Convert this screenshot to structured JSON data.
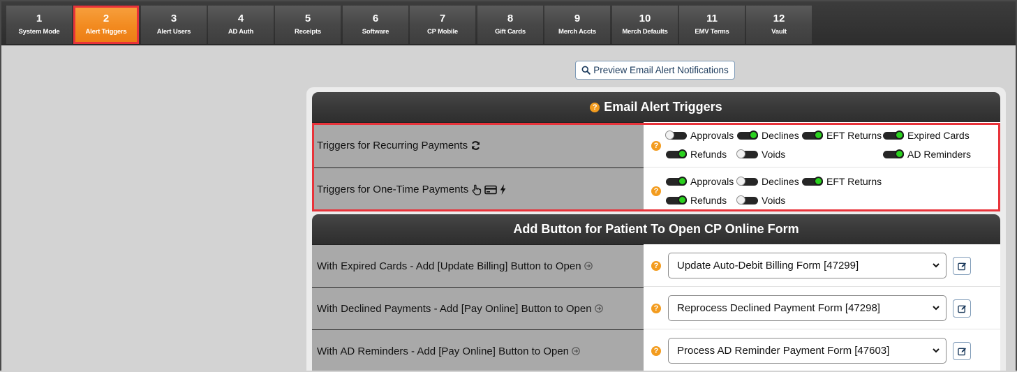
{
  "tabs": [
    {
      "num": "1",
      "label": "System Mode",
      "active": false
    },
    {
      "num": "2",
      "label": "Alert Triggers",
      "active": true
    },
    {
      "num": "3",
      "label": "Alert Users",
      "active": false
    },
    {
      "num": "4",
      "label": "AD Auth",
      "active": false
    },
    {
      "num": "5",
      "label": "Receipts",
      "active": false
    },
    {
      "num": "6",
      "label": "Software",
      "active": false
    },
    {
      "num": "7",
      "label": "CP Mobile",
      "active": false
    },
    {
      "num": "8",
      "label": "Gift Cards",
      "active": false
    },
    {
      "num": "9",
      "label": "Merch Accts",
      "active": false
    },
    {
      "num": "10",
      "label": "Merch Defaults",
      "active": false
    },
    {
      "num": "11",
      "label": "EMV Terms",
      "active": false
    },
    {
      "num": "12",
      "label": "Vault",
      "active": false
    }
  ],
  "preview_button": {
    "label": "Preview Email Alert Notifications",
    "icon": "search-icon"
  },
  "email_triggers": {
    "title": "Email Alert Triggers",
    "help_glyph": "?",
    "recurring": {
      "label": "Triggers for Recurring Payments",
      "icon": "refresh-icon",
      "toggles": {
        "approvals": {
          "label": "Approvals",
          "on": false
        },
        "declines": {
          "label": "Declines",
          "on": true
        },
        "eft_returns": {
          "label": "EFT Returns",
          "on": true
        },
        "expired_cards": {
          "label": "Expired Cards",
          "on": true
        },
        "refunds": {
          "label": "Refunds",
          "on": true
        },
        "voids": {
          "label": "Voids",
          "on": false
        },
        "ad_reminders": {
          "label": "AD Reminders",
          "on": true
        }
      }
    },
    "one_time": {
      "label": "Triggers for One-Time Payments",
      "icons": [
        "pointer-hand-icon",
        "credit-card-icon",
        "bolt-icon"
      ],
      "toggles": {
        "approvals": {
          "label": "Approvals",
          "on": true
        },
        "declines": {
          "label": "Declines",
          "on": false
        },
        "eft_returns": {
          "label": "EFT Returns",
          "on": true
        },
        "refunds": {
          "label": "Refunds",
          "on": true
        },
        "voids": {
          "label": "Voids",
          "on": false
        }
      }
    }
  },
  "online_form": {
    "title": "Add Button for Patient To Open CP Online Form",
    "rows": [
      {
        "label": "With Expired Cards - Add [Update Billing] Button to Open",
        "selected": "Update Auto-Debit Billing Form [47299]"
      },
      {
        "label": "With Declined Payments - Add [Pay Online] Button to Open",
        "selected": "Reprocess Declined Payment Form [47298]"
      },
      {
        "label": "With AD Reminders - Add [Pay Online] Button to Open",
        "selected": "Process AD Reminder Payment Form [47603]"
      }
    ]
  },
  "colors": {
    "accent_orange": "#f28a1f",
    "highlight_red": "#e8333a",
    "toggle_on": "#2ad11e",
    "help": "#f39c1f"
  }
}
